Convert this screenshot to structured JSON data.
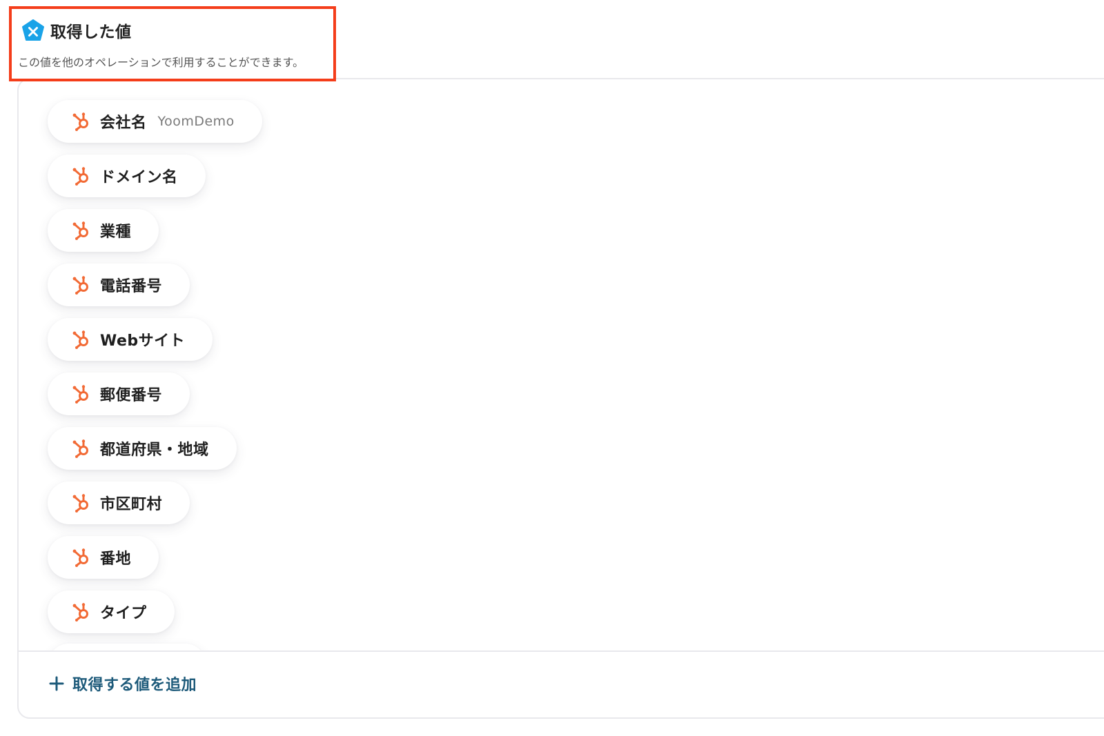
{
  "header": {
    "icon": "yoom-logo-icon",
    "title": "取得した値",
    "description": "この値を他のオペレーションで利用することができます。"
  },
  "fields": [
    {
      "label": "会社名",
      "value": "YoomDemo",
      "icon": "hubspot-icon"
    },
    {
      "label": "ドメイン名",
      "value": "",
      "icon": "hubspot-icon"
    },
    {
      "label": "業種",
      "value": "",
      "icon": "hubspot-icon"
    },
    {
      "label": "電話番号",
      "value": "",
      "icon": "hubspot-icon"
    },
    {
      "label": "Webサイト",
      "value": "",
      "icon": "hubspot-icon"
    },
    {
      "label": "郵便番号",
      "value": "",
      "icon": "hubspot-icon"
    },
    {
      "label": "都道府県・地域",
      "value": "",
      "icon": "hubspot-icon"
    },
    {
      "label": "市区町村",
      "value": "",
      "icon": "hubspot-icon"
    },
    {
      "label": "番地",
      "value": "",
      "icon": "hubspot-icon"
    },
    {
      "label": "タイプ",
      "value": "",
      "icon": "hubspot-icon"
    }
  ],
  "footer": {
    "add_label": "取得する値を追加"
  },
  "colors": {
    "highlight": "#f43d1a",
    "hubspot": "#f26a35",
    "yoom": "#1aa3e8",
    "add_text": "#1d5a7a"
  }
}
